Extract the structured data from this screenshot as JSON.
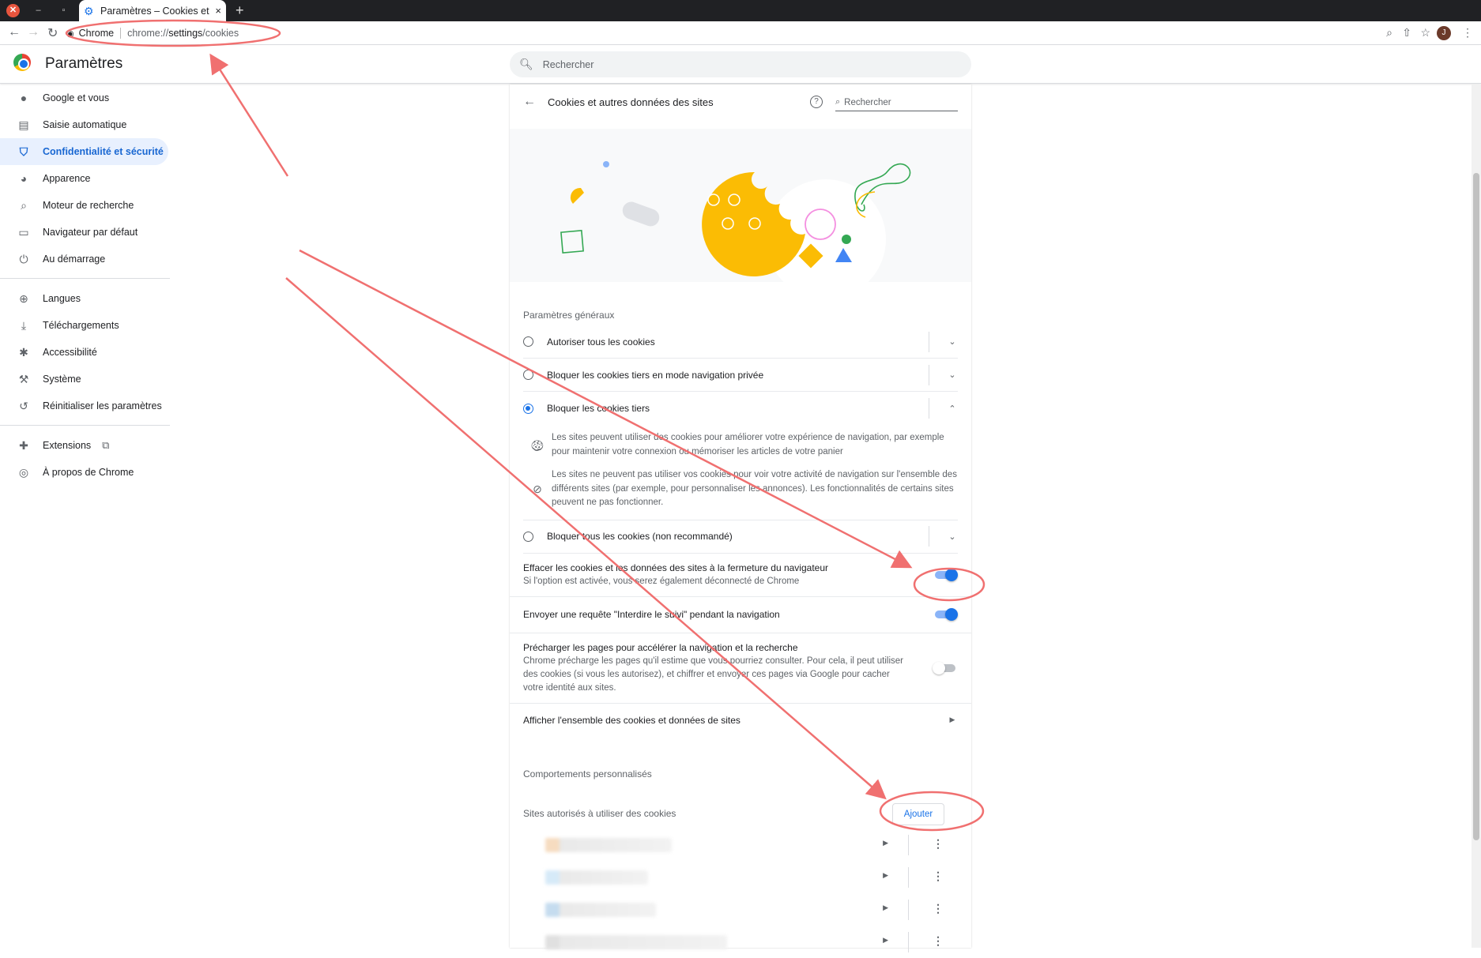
{
  "tab": {
    "title": "Paramètres – Cookies et a",
    "close": "×",
    "new_tab": "+"
  },
  "window": {
    "close": "✕",
    "minimize": "–",
    "maximize": "▫"
  },
  "omnibox": {
    "chip": "Chrome",
    "url_prefix": "chrome://",
    "url_host": "settings",
    "url_path": "/cookies"
  },
  "profile": {
    "initial": "J"
  },
  "header": {
    "title": "Paramètres",
    "search_placeholder": "Rechercher"
  },
  "sidebar": {
    "items": [
      {
        "label": "Google et vous",
        "icon": "person-icon",
        "glyph": "👤"
      },
      {
        "label": "Saisie automatique",
        "icon": "clipboard-icon",
        "glyph": "📋"
      },
      {
        "label": "Confidentialité et sécurité",
        "icon": "shield-icon",
        "glyph": "🛡"
      },
      {
        "label": "Apparence",
        "icon": "palette-icon",
        "glyph": "🎨"
      },
      {
        "label": "Moteur de recherche",
        "icon": "search-icon",
        "glyph": "🔍"
      },
      {
        "label": "Navigateur par défaut",
        "icon": "browser-icon",
        "glyph": "▭"
      },
      {
        "label": "Au démarrage",
        "icon": "power-icon",
        "glyph": "⏻"
      },
      {
        "label": "Langues",
        "icon": "globe-icon",
        "glyph": "🌐"
      },
      {
        "label": "Téléchargements",
        "icon": "download-icon",
        "glyph": "⬇"
      },
      {
        "label": "Accessibilité",
        "icon": "accessibility-icon",
        "glyph": "♿"
      },
      {
        "label": "Système",
        "icon": "wrench-icon",
        "glyph": "🔧"
      },
      {
        "label": "Réinitialiser les paramètres",
        "icon": "restore-icon",
        "glyph": "↺"
      },
      {
        "label": "Extensions",
        "icon": "puzzle-icon",
        "glyph": "🧩"
      },
      {
        "label": "À propos de Chrome",
        "icon": "chrome-icon",
        "glyph": "◉"
      }
    ]
  },
  "page": {
    "title": "Cookies et autres données des sites",
    "search_placeholder": "Rechercher",
    "general_heading": "Paramètres généraux",
    "options": [
      {
        "label": "Autoriser tous les cookies",
        "selected": false
      },
      {
        "label": "Bloquer les cookies tiers en mode navigation privée",
        "selected": false
      },
      {
        "label": "Bloquer les cookies tiers",
        "selected": true
      },
      {
        "label": "Bloquer tous les cookies (non recommandé)",
        "selected": false
      }
    ],
    "expanded": [
      "Les sites peuvent utiliser des cookies pour améliorer votre expérience de navigation, par exemple pour maintenir votre connexion ou mémoriser les articles de votre panier",
      "Les sites ne peuvent pas utiliser vos cookies pour voir votre activité de navigation sur l'ensemble des différents sites (par exemple, pour personnaliser les annonces). Les fonctionnalités de certains sites peuvent ne pas fonctionner."
    ],
    "toggles": [
      {
        "label": "Effacer les cookies et les données des sites à la fermeture du navigateur",
        "sub": "Si l'option est activée, vous serez également déconnecté de Chrome",
        "on": true
      },
      {
        "label": "Envoyer une requête \"Interdire le suivi\" pendant la navigation",
        "sub": "",
        "on": true
      },
      {
        "label": "Précharger les pages pour accélérer la navigation et la recherche",
        "sub": "Chrome précharge les pages qu'il estime que vous pourriez consulter. Pour cela, il peut utiliser des cookies (si vous les autorisez), et chiffrer et envoyer ces pages via Google pour cacher votre identité aux sites.",
        "on": false
      }
    ],
    "see_all": "Afficher l'ensemble des cookies et données de sites",
    "custom_heading": "Comportements personnalisés",
    "allowed_heading": "Sites autorisés à utiliser des cookies",
    "add_button": "Ajouter"
  },
  "colors": {
    "accent": "#1a73e8",
    "annotation": "#f07070",
    "cookie": "#fbbc04"
  }
}
